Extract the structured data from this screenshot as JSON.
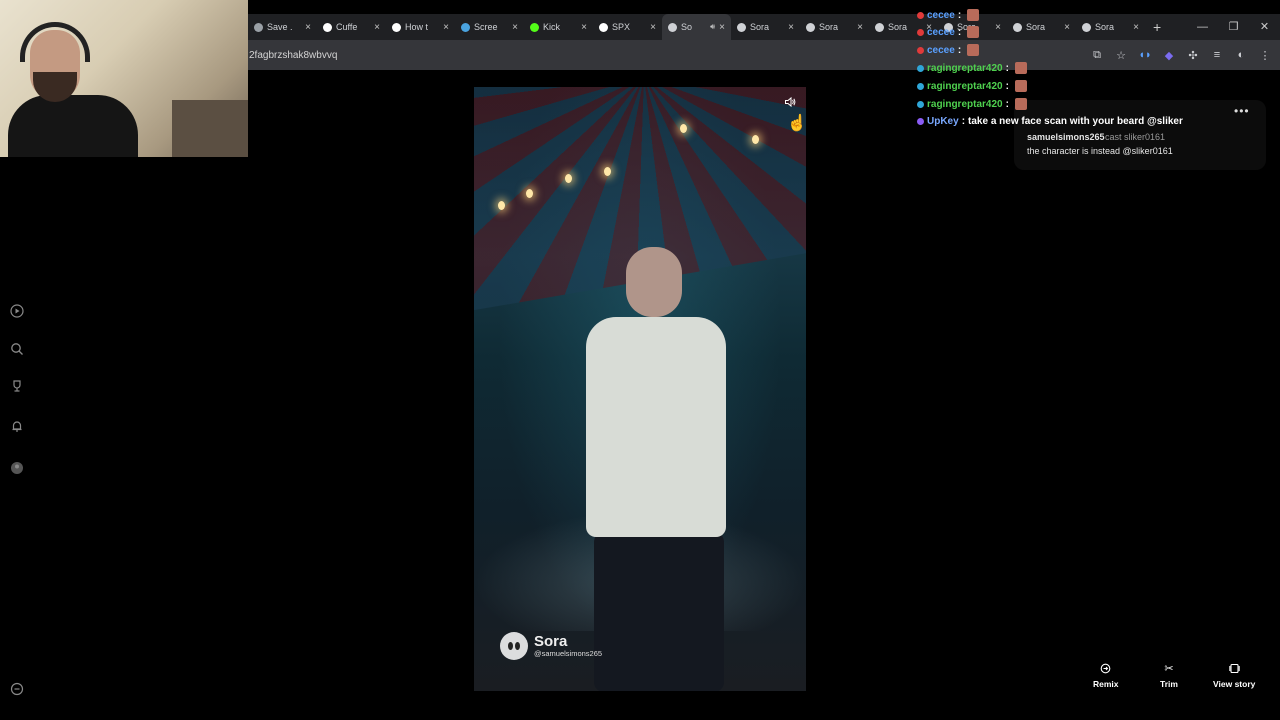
{
  "browser": {
    "tabs": [
      {
        "title": "Save .",
        "icon": "page-icon",
        "color": "#9aa0a6"
      },
      {
        "title": "Cuffe",
        "icon": "tiktok-icon",
        "color": "#ffffff"
      },
      {
        "title": "How t",
        "icon": "tiktok-icon",
        "color": "#ffffff"
      },
      {
        "title": "Scree",
        "icon": "screen-icon",
        "color": "#4aa3df"
      },
      {
        "title": "Kick",
        "icon": "kick-icon",
        "color": "#53fc18"
      },
      {
        "title": "SPX",
        "icon": "x-icon",
        "color": "#ffffff"
      },
      {
        "title": "So",
        "icon": "sora-icon",
        "color": "#cfd1d5",
        "active": true
      },
      {
        "title": "Sora",
        "icon": "sora-icon",
        "color": "#cfd1d5"
      },
      {
        "title": "Sora",
        "icon": "sora-icon",
        "color": "#cfd1d5"
      },
      {
        "title": "Sora",
        "icon": "sora-icon",
        "color": "#cfd1d5"
      },
      {
        "title": "Sora",
        "icon": "sora-icon",
        "color": "#cfd1d5"
      },
      {
        "title": "Sora",
        "icon": "sora-icon",
        "color": "#cfd1d5"
      },
      {
        "title": "Sora",
        "icon": "sora-icon",
        "color": "#cfd1d5"
      }
    ],
    "new_tab": "+",
    "window_controls": {
      "minimize": "—",
      "restore": "❐",
      "close": "✕"
    },
    "url": "2fagbrzshak8wbvvq"
  },
  "video": {
    "brand": "Sora",
    "handle": "@samuelsimons265",
    "sound_icon": "speaker-icon"
  },
  "chat": [
    {
      "user": "cecee",
      "color": "#5aa0ff",
      "badge_color": "#e03a3a"
    },
    {
      "user": "cecee",
      "color": "#5aa0ff",
      "badge_color": "#e03a3a"
    },
    {
      "user": "cecee",
      "color": "#5aa0ff",
      "badge_color": "#e03a3a"
    },
    {
      "user": "ragingreptar420",
      "color": "#4fd14f",
      "badge_color": "#2fa6d8"
    },
    {
      "user": "ragingreptar420",
      "color": "#4fd14f",
      "badge_color": "#2fa6d8"
    },
    {
      "user": "ragingreptar420",
      "color": "#4fd14f",
      "badge_color": "#2fa6d8"
    },
    {
      "user": "UpKey",
      "color": "#7aa8ff",
      "badge_color": "#8a5cf5",
      "message": "take a new face scan with your beard @sliker"
    }
  ],
  "comment": {
    "user": "samuelsimons265",
    "cast": "cast sliker0161",
    "text": "the character is instead @sliker0161"
  },
  "actions": {
    "remix": "Remix",
    "trim": "Trim",
    "view_story": "View story"
  }
}
